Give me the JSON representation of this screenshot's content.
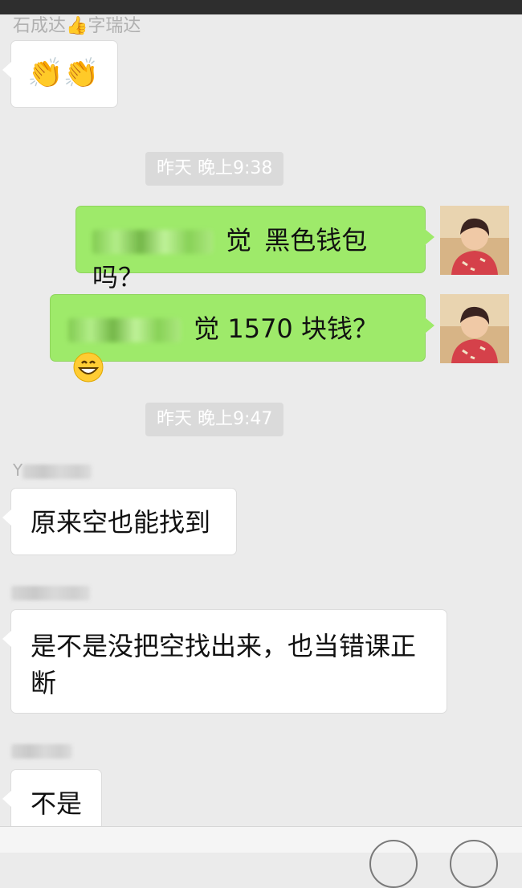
{
  "chat": {
    "messages": [
      {
        "sender": "石成达👍字瑞达",
        "text": "👏👏"
      },
      {
        "timestamp": "昨天 晚上9:38"
      },
      {
        "text_visible": "黑色钱包吗？",
        "partial_char": "觉",
        "direction": "out"
      },
      {
        "text_visible": "觉 1570 块钱？",
        "direction": "out"
      },
      {
        "timestamp": "昨天 晚上9:47"
      },
      {
        "sender_partial": "Y",
        "text": "原来空也能找到"
      },
      {
        "text": "是不是没把空找出来，也当错课正断"
      },
      {
        "text": "不是"
      }
    ]
  },
  "colors": {
    "outgoing_bubble": "#9eea6a",
    "incoming_bubble": "#ffffff",
    "background": "#ebebeb"
  }
}
